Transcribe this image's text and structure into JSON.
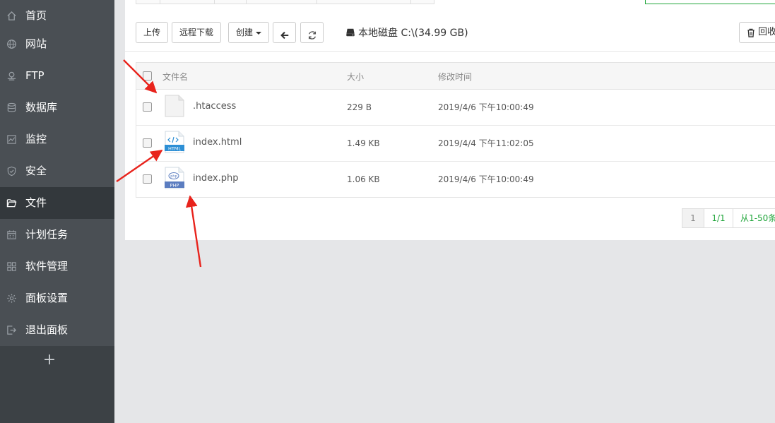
{
  "sidebar": {
    "items": [
      {
        "label": "首页",
        "icon": "home-icon"
      },
      {
        "label": "网站",
        "icon": "globe-icon"
      },
      {
        "label": "FTP",
        "icon": "ftp-icon"
      },
      {
        "label": "数据库",
        "icon": "database-icon"
      },
      {
        "label": "监控",
        "icon": "chart-icon"
      },
      {
        "label": "安全",
        "icon": "shield-icon"
      },
      {
        "label": "文件",
        "icon": "folder-icon",
        "active": true
      },
      {
        "label": "计划任务",
        "icon": "calendar-icon"
      },
      {
        "label": "软件管理",
        "icon": "apps-icon"
      },
      {
        "label": "面板设置",
        "icon": "gear-icon"
      },
      {
        "label": "退出面板",
        "icon": "logout-icon"
      }
    ],
    "add_label": "+"
  },
  "toolbar": {
    "upload": "上传",
    "remote_download": "远程下载",
    "create": "创建",
    "disk": "本地磁盘 C:\\(34.99 GB)",
    "recycle": "回收"
  },
  "table": {
    "headers": {
      "name": "文件名",
      "size": "大小",
      "mtime": "修改时间"
    },
    "rows": [
      {
        "name": ".htaccess",
        "size": "229 B",
        "mtime": "2019/4/6 下午10:00:49",
        "icon": "file-icon"
      },
      {
        "name": "index.html",
        "size": "1.49 KB",
        "mtime": "2019/4/4 下午11:02:05",
        "icon": "html-file-icon",
        "badge": "HTML"
      },
      {
        "name": "index.php",
        "size": "1.06 KB",
        "mtime": "2019/4/6 下午10:00:49",
        "icon": "php-file-icon",
        "badge": "PHP",
        "glyph": "php"
      }
    ]
  },
  "pagination": {
    "current": "1",
    "pages": "1/1",
    "range": "从1-50条"
  },
  "colors": {
    "sidebar_bg": "#4a4f54",
    "sidebar_active": "#33383c",
    "accent_green": "#20a53a",
    "annotation_red": "#e8231c"
  }
}
